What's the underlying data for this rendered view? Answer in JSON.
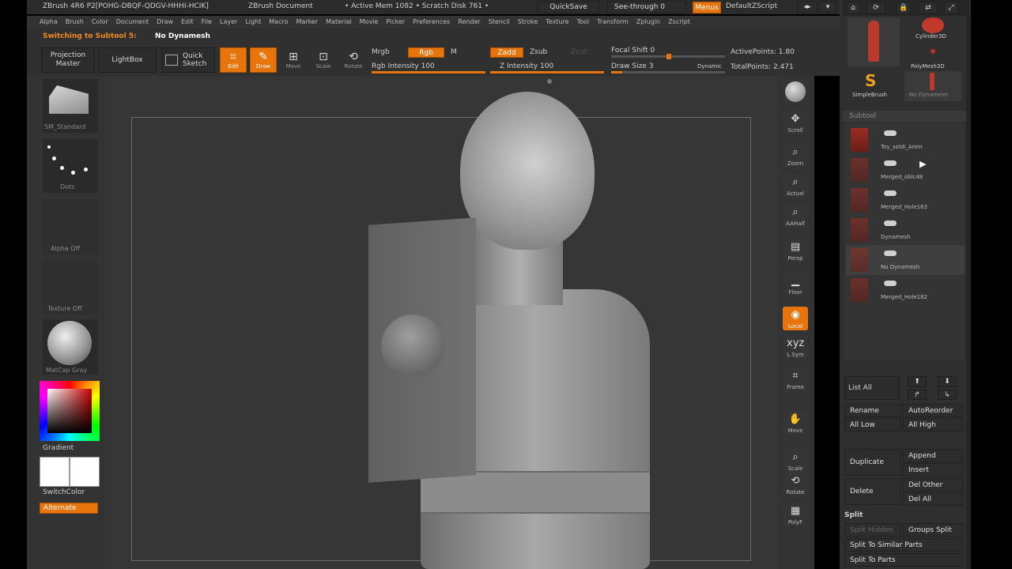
{
  "title_bar": {
    "app": "ZBrush 4R6 P2[POHG-DBQF-QDGV-HHHI-HCIK]",
    "document": "ZBrush Document",
    "active_mem": "• Active Mem 1082 • Scratch Disk 761 •",
    "quicksave": "QuickSave",
    "see_through": "See-through  0",
    "menus": "Menus",
    "default_zscript": "DefaultZScript"
  },
  "menu_bar": [
    "Alpha",
    "Brush",
    "Color",
    "Document",
    "Draw",
    "Edit",
    "File",
    "Layer",
    "Light",
    "Macro",
    "Marker",
    "Material",
    "Movie",
    "Picker",
    "Preferences",
    "Render",
    "Stencil",
    "Stroke",
    "Texture",
    "Tool",
    "Transform",
    "Zplugin",
    "Zscript"
  ],
  "status": {
    "label": "Switching to Subtool 5:",
    "value": "No Dynamesh"
  },
  "toolbar": {
    "projection_master": "Projection Master",
    "lightbox": "LightBox",
    "quick_sketch": "Quick Sketch",
    "edit": "Edit",
    "draw": "Draw",
    "move": "Move",
    "scale": "Scale",
    "rotate": "Rotate",
    "mrgb": "Mrgb",
    "rgb": "Rgb",
    "m": "M",
    "rgb_intensity": "Rgb Intensity 100",
    "zadd": "Zadd",
    "zsub": "Zsub",
    "zcut": "Zcut",
    "z_intensity": "Z Intensity 100",
    "focal_shift": "Focal Shift 0",
    "draw_size": "Draw Size 3",
    "dynamic": "Dynamic",
    "active_points": "ActivePoints: 1.80",
    "total_points": "TotalPoints: 2.471"
  },
  "left_shelf": {
    "brush": "SM_Standard",
    "stroke": "Dots",
    "alpha": "Alpha Off",
    "texture": "Texture Off",
    "material": "MatCap Gray",
    "gradient": "Gradient",
    "switch_color": "SwitchColor",
    "alternate": "Alternate"
  },
  "right_shelf": [
    {
      "label": "BPR",
      "active": false,
      "icon": "bpr-icon",
      "glyph": ""
    },
    {
      "label": "Scroll",
      "active": false,
      "icon": "scroll-icon",
      "glyph": "✥"
    },
    {
      "label": "Zoom",
      "active": false,
      "icon": "zoom-icon",
      "glyph": "⌕"
    },
    {
      "label": "Actual",
      "active": false,
      "icon": "actual-icon",
      "glyph": "⌕"
    },
    {
      "label": "AAHalf",
      "active": false,
      "icon": "aahalf-icon",
      "glyph": "⌕"
    },
    {
      "label": "Persp",
      "active": false,
      "icon": "persp-icon",
      "glyph": "▤"
    },
    {
      "label": "Floor",
      "active": false,
      "icon": "floor-icon",
      "glyph": "▁"
    },
    {
      "label": "Local",
      "active": true,
      "icon": "local-icon",
      "glyph": "◉"
    },
    {
      "label": "L.Sym",
      "active": false,
      "icon": "lsym-icon",
      "glyph": "xyz"
    },
    {
      "label": "Frame",
      "active": false,
      "icon": "frame-icon",
      "glyph": "⌗"
    },
    {
      "label": "Move",
      "active": false,
      "icon": "move-icon",
      "glyph": "✋"
    },
    {
      "label": "Scale",
      "active": false,
      "icon": "scale-icon",
      "glyph": "⌕"
    },
    {
      "label": "Rotate",
      "active": false,
      "icon": "rotate-icon",
      "glyph": "⟲"
    },
    {
      "label": "PolyF",
      "active": false,
      "icon": "polyf-icon",
      "glyph": "▦"
    }
  ],
  "right_tray": {
    "tools": [
      "Cylinder3D",
      "PolyMesh3D",
      "SimpleBrush",
      "No Dynamesh"
    ],
    "subtool_header": "Subtool",
    "subtools": [
      "Toy_soldi_Anim",
      "Merged_oblc48",
      "Merged_Hole183",
      "Dynamesh",
      "No Dynamesh",
      "Merged_Hole182"
    ],
    "list_all": "List All",
    "rename": "Rename",
    "auto_reorder": "AutoReorder",
    "all_low": "All Low",
    "all_high": "All High",
    "duplicate": "Duplicate",
    "append": "Append",
    "insert": "Insert",
    "delete": "Delete",
    "del_other": "Del Other",
    "del_all": "Del All",
    "split_header": "Split",
    "split_hidden": "Split Hidden",
    "groups_split": "Groups Split",
    "split_similar": "Split To Similar Parts",
    "split_parts": "Split To Parts"
  },
  "colors": {
    "accent": "#e8740c",
    "panel": "#3a3a3a",
    "canvas": "#363636"
  }
}
